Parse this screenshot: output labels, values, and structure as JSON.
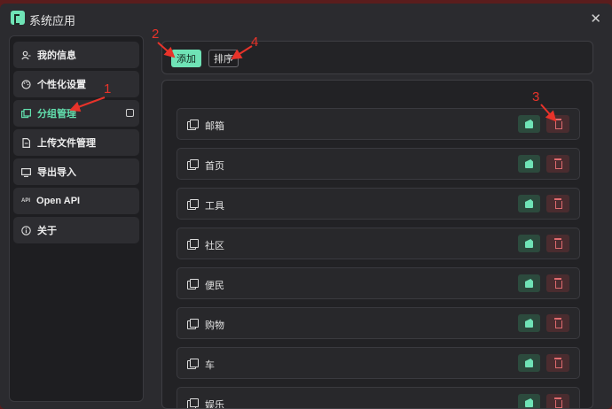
{
  "window": {
    "title": "系统应用",
    "close_glyph": "✕"
  },
  "sidebar": {
    "items": [
      {
        "label": "我的信息",
        "icon": "user-icon"
      },
      {
        "label": "个性化设置",
        "icon": "palette-icon"
      },
      {
        "label": "分组管理",
        "icon": "group-icon",
        "active": true
      },
      {
        "label": "上传文件管理",
        "icon": "file-icon"
      },
      {
        "label": "导出导入",
        "icon": "export-import-icon"
      },
      {
        "label": "Open API",
        "icon": "api-icon",
        "tag": "API"
      },
      {
        "label": "关于",
        "icon": "info-icon"
      }
    ]
  },
  "toolbar": {
    "add_label": "添加",
    "sort_label": "排序"
  },
  "groups": [
    {
      "name": "邮箱"
    },
    {
      "name": "首页"
    },
    {
      "name": "工具"
    },
    {
      "name": "社区"
    },
    {
      "name": "便民"
    },
    {
      "name": "购物"
    },
    {
      "name": "车"
    },
    {
      "name": "娱乐"
    }
  ],
  "annotations": {
    "a1": "1",
    "a2": "2",
    "a3": "3",
    "a4": "4"
  },
  "colors": {
    "accent": "#6fe3b6",
    "danger": "#e06b6f",
    "annotation": "#e8332a"
  }
}
